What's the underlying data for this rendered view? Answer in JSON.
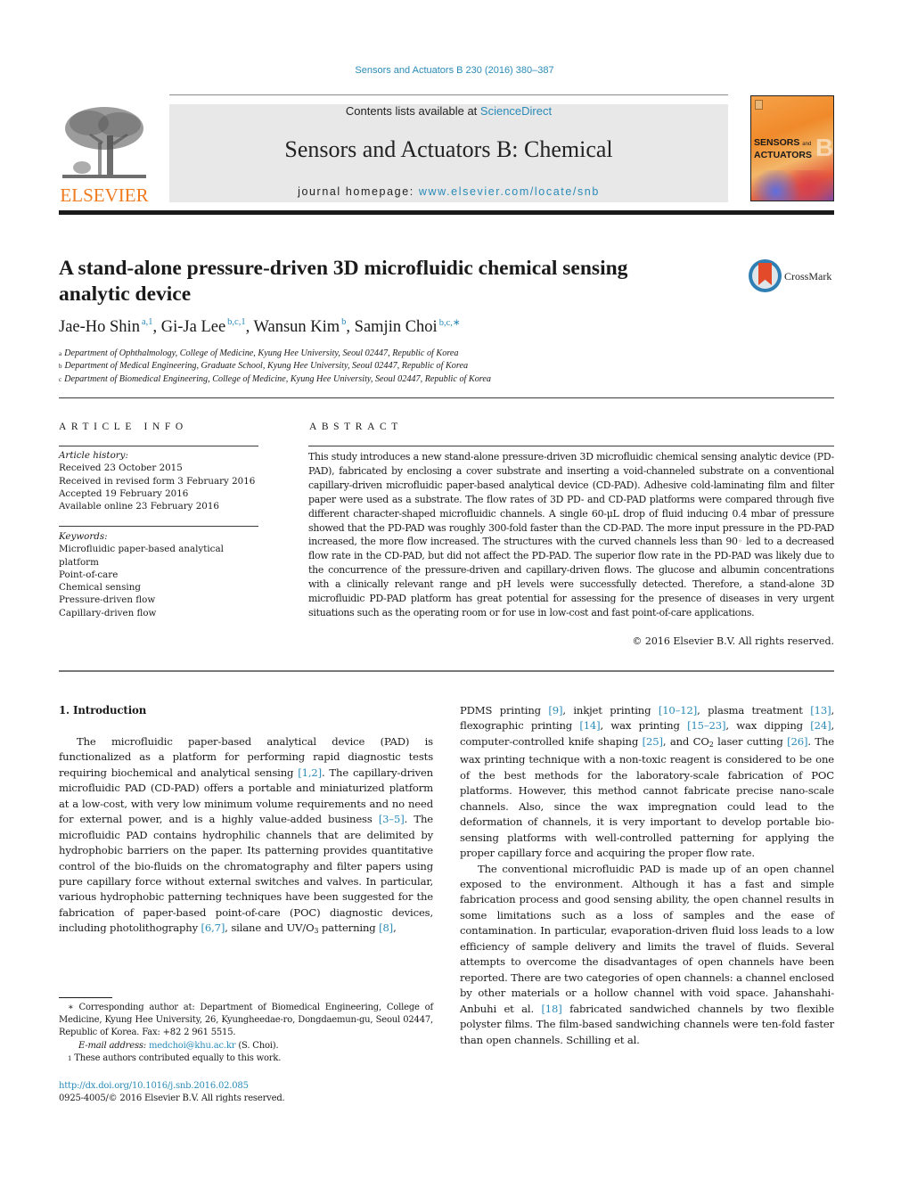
{
  "header": {
    "citation": "Sensors and Actuators B 230 (2016) 380–387",
    "contents_prefix": "Contents lists available at ",
    "contents_link": "ScienceDirect",
    "journal_title": "Sensors and Actuators B: Chemical",
    "homepage_prefix": "journal homepage: ",
    "homepage_link": "www.elsevier.com/locate/snb",
    "publisher_logo_text": "ELSEVIER",
    "cover": {
      "line1": "SENSORS",
      "and": "and",
      "line2": "ACTUATORS",
      "letter": "B"
    },
    "colors": {
      "link": "#2a8bb8",
      "elsevier_orange": "#f07a1e",
      "masthead_bg": "#e8e8e8"
    }
  },
  "article": {
    "title": "A stand-alone pressure-driven 3D microfluidic chemical sensing analytic device",
    "crossmark_label": "CrossMark",
    "authors": [
      {
        "name": "Jae-Ho Shin",
        "marks": "a,1"
      },
      {
        "name": "Gi-Ja Lee",
        "marks": "b,c,1"
      },
      {
        "name": "Wansun Kim",
        "marks": "b"
      },
      {
        "name": "Samjin Choi",
        "marks": "b,c,∗"
      }
    ],
    "affiliations": [
      {
        "mark": "a",
        "text": "Department of Ophthalmology, College of Medicine, Kyung Hee University, Seoul 02447, Republic of Korea"
      },
      {
        "mark": "b",
        "text": "Department of Medical Engineering, Graduate School, Kyung Hee University, Seoul 02447, Republic of Korea"
      },
      {
        "mark": "c",
        "text": "Department of Biomedical Engineering, College of Medicine, Kyung Hee University, Seoul 02447, Republic of Korea"
      }
    ]
  },
  "article_info": {
    "heading": "ARTICLE INFO",
    "history_label": "Article history:",
    "history": [
      "Received 23 October 2015",
      "Received in revised form 3 February 2016",
      "Accepted 19 February 2016",
      "Available online 23 February 2016"
    ],
    "keywords_label": "Keywords:",
    "keywords": [
      "Microfluidic paper-based analytical platform",
      "Point-of-care",
      "Chemical sensing",
      "Pressure-driven flow",
      "Capillary-driven flow"
    ]
  },
  "abstract": {
    "heading": "ABSTRACT",
    "text_1": "This study introduces a new stand-alone pressure-driven 3D microfluidic chemical sensing analytic device (PD-PAD), fabricated by enclosing a cover substrate and inserting a void-channeled substrate on a conventional capillary-driven microfluidic paper-based analytical device (CD-PAD). Adhesive cold-laminating film and filter paper were used as a substrate. The flow rates of 3D PD- and CD-PAD platforms were compared through five different character-shaped microfluidic channels. A single 60-μL drop of fluid inducing 0.4 mbar of pressure showed that the PD-PAD was roughly 300-fold faster than the CD-PAD. The more input pressure in the PD-PAD increased, the more flow increased. The structures with the curved channels less than 90",
    "degree": "◦",
    "text_2": " led to a decreased flow rate in the CD-PAD, but did not affect the PD-PAD. The superior flow rate in the PD-PAD was likely due to the concurrence of the pressure-driven and capillary-driven flows. The glucose and albumin concentrations with a clinically relevant range and pH levels were successfully detected. Therefore, a stand-alone 3D microfluidic PD-PAD platform has great potential for assessing for the presence of diseases in very urgent situations such as the operating room or for use in low-cost and fast point-of-care applications.",
    "copyright": "© 2016 Elsevier B.V. All rights reserved."
  },
  "body": {
    "section_heading": "1.  Introduction",
    "left": {
      "p1_a": "The microfluidic paper-based analytical device (PAD) is functionalized as a platform for performing rapid diagnostic tests requiring biochemical and analytical sensing ",
      "ref_1": "[1,2]",
      "p1_b": ". The capillary-driven microfluidic PAD (CD-PAD) offers a portable and miniaturized platform at a low-cost, with very low minimum volume requirements and no need for external power, and is a highly value-added business ",
      "ref_2": "[3–5]",
      "p1_c": ". The microfluidic PAD contains hydrophilic channels that are delimited by hydrophobic barriers on the paper. Its patterning provides quantitative control of the bio-fluids on the chromatography and filter papers using pure capillary force without external switches and valves. In particular, various hydrophobic patterning techniques have been suggested for the fabrication of paper-based point-of-care (POC) diagnostic devices, including photolithography ",
      "ref_3": "[6,7]",
      "p1_d": ", silane and UV/O",
      "sub_3": "3",
      "p1_e": " patterning ",
      "ref_4": "[8]",
      "p1_f": ","
    },
    "right": {
      "p1_a": "PDMS printing ",
      "ref_1": "[9]",
      "p1_b": ", inkjet printing ",
      "ref_2": "[10–12]",
      "p1_c": ", plasma treatment ",
      "ref_3": "[13]",
      "p1_d": ", flexographic printing ",
      "ref_4": "[14]",
      "p1_e": ", wax printing ",
      "ref_5": "[15–23]",
      "p1_f": ", wax dipping ",
      "ref_6": "[24]",
      "p1_g": ", computer-controlled knife shaping ",
      "ref_7": "[25]",
      "p1_h": ", and CO",
      "sub_2": "2",
      "p1_i": " laser cutting ",
      "ref_8": "[26]",
      "p1_j": ". The wax printing technique with a non-toxic reagent is considered to be one of the best methods for the laboratory-scale fabrication of POC platforms. However, this method cannot fabricate precise nano-scale channels. Also, since the wax impregnation could lead to the deformation of channels, it is very important to develop portable bio-sensing platforms with well-controlled patterning for applying the proper capillary force and acquiring the proper flow rate.",
      "p2_a": "The conventional microfluidic PAD is made up of an open channel exposed to the environment. Although it has a fast and simple fabrication process and good sensing ability, the open channel results in some limitations such as a loss of samples and the ease of contamination. In particular, evaporation-driven fluid loss leads to a low efficiency of sample delivery and limits the travel of fluids. Several attempts to overcome the disadvantages of open channels have been reported. There are two categories of open channels: a channel enclosed by other materials or a hollow channel with void space. Jahanshahi-Anbuhi et al. ",
      "ref_9": "[18]",
      "p2_b": " fabricated sandwiched channels by two flexible polyster films. The film-based sandwiching channels were ten-fold faster than open channels. Schilling et al."
    }
  },
  "footnotes": {
    "corresponding": "∗  Corresponding author at: Department of Biomedical Engineering, College of Medicine, Kyung Hee University, 26, Kyungheedae-ro, Dongdaemun-gu, Seoul 02447, Republic of Korea. Fax: +82 2 961 5515.",
    "email_label": "E-mail address: ",
    "email": "medchoi@khu.ac.kr",
    "email_suffix": " (S. Choi).",
    "equal_mark": "1",
    "equal": "  These authors contributed equally to this work.",
    "doi": "http://dx.doi.org/10.1016/j.snb.2016.02.085",
    "issn": "0925-4005/© 2016 Elsevier B.V. All rights reserved."
  }
}
